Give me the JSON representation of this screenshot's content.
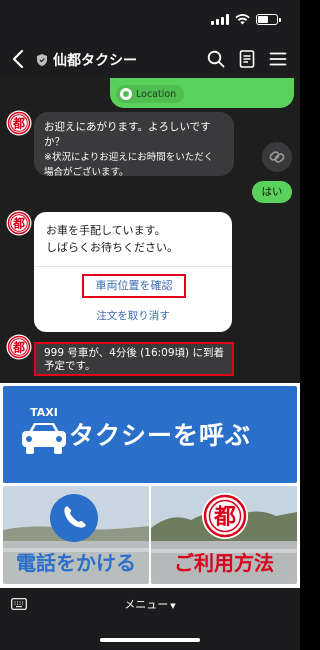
{
  "header": {
    "title": "仙都タクシー",
    "icons": [
      "back-icon",
      "shield-icon",
      "search-icon",
      "notes-icon",
      "menu-icon"
    ]
  },
  "chat": {
    "location_label": "Location",
    "msg1": {
      "lines": [
        "お迎えにあがります。よろしいです",
        "か？",
        "※状況によりお迎えにお時間をいただく",
        "場合がございます。"
      ]
    },
    "reply": "はい",
    "card": {
      "lines": [
        "お車を手配しています。",
        "しばらくお待ちください。"
      ],
      "action_check": "車両位置を確認",
      "action_cancel": "注文を取り消す"
    },
    "arrival": {
      "lines": [
        "999 号車が、4分後 (16:09頃) に到着",
        "予定です。"
      ]
    }
  },
  "rich_menu": {
    "taxi_badge": "TAXI",
    "call_taxi": "タクシーを呼ぶ",
    "call_phone": "電話をかける",
    "how_to_use": "ご利用方法",
    "logo_char": "都"
  },
  "bottom_bar": {
    "menu_label": "メニュー"
  },
  "colors": {
    "accent_green": "#5ad15a",
    "accent_blue": "#2a6fc9",
    "highlight_red": "#e3001b",
    "bubble_dark": "#3a3a3c",
    "link_blue": "#3b6bb5"
  }
}
